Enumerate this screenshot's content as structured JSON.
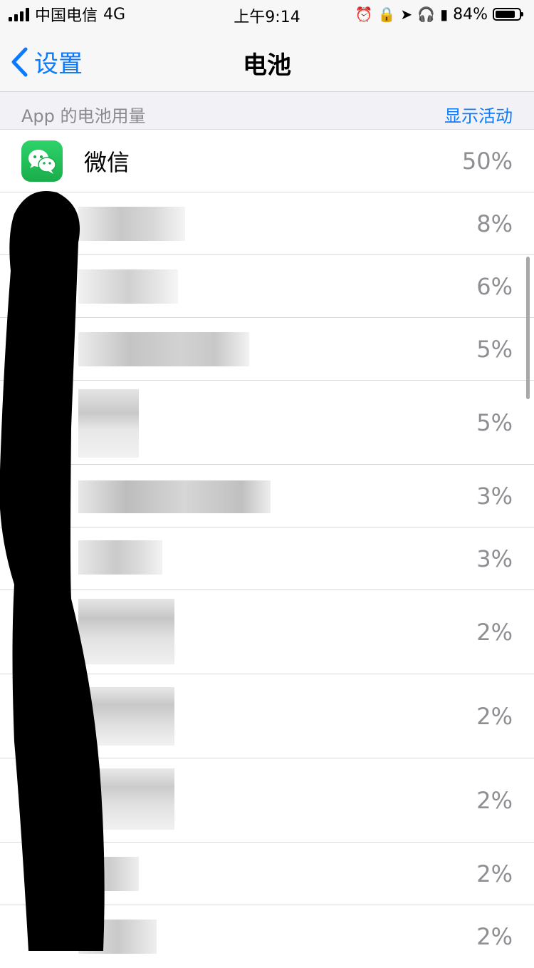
{
  "status_bar": {
    "carrier": "中国电信",
    "network": "4G",
    "time": "上午9:14",
    "battery_percent": "84%",
    "battery_level": 0.84
  },
  "nav": {
    "back_label": "设置",
    "title": "电池"
  },
  "section": {
    "label": "App 的电池用量",
    "action": "显示活动"
  },
  "apps": [
    {
      "name": "微信",
      "percent": "50%",
      "icon": "wechat-icon"
    },
    {
      "name": "",
      "percent": "8%"
    },
    {
      "name": "",
      "percent": "6%"
    },
    {
      "name": "",
      "percent": "5%"
    },
    {
      "name": "",
      "percent": "5%"
    },
    {
      "name": "",
      "percent": "3%"
    },
    {
      "name": "",
      "percent": "3%"
    },
    {
      "name": "",
      "percent": "2%"
    },
    {
      "name": "",
      "percent": "2%"
    },
    {
      "name": "",
      "percent": "2%"
    },
    {
      "name": "",
      "percent": "2%"
    },
    {
      "name": "",
      "percent": "2%"
    }
  ],
  "colors": {
    "accent": "#0a7aff",
    "wechat": "#1aad4b",
    "secondary_text": "#8e8e93"
  }
}
